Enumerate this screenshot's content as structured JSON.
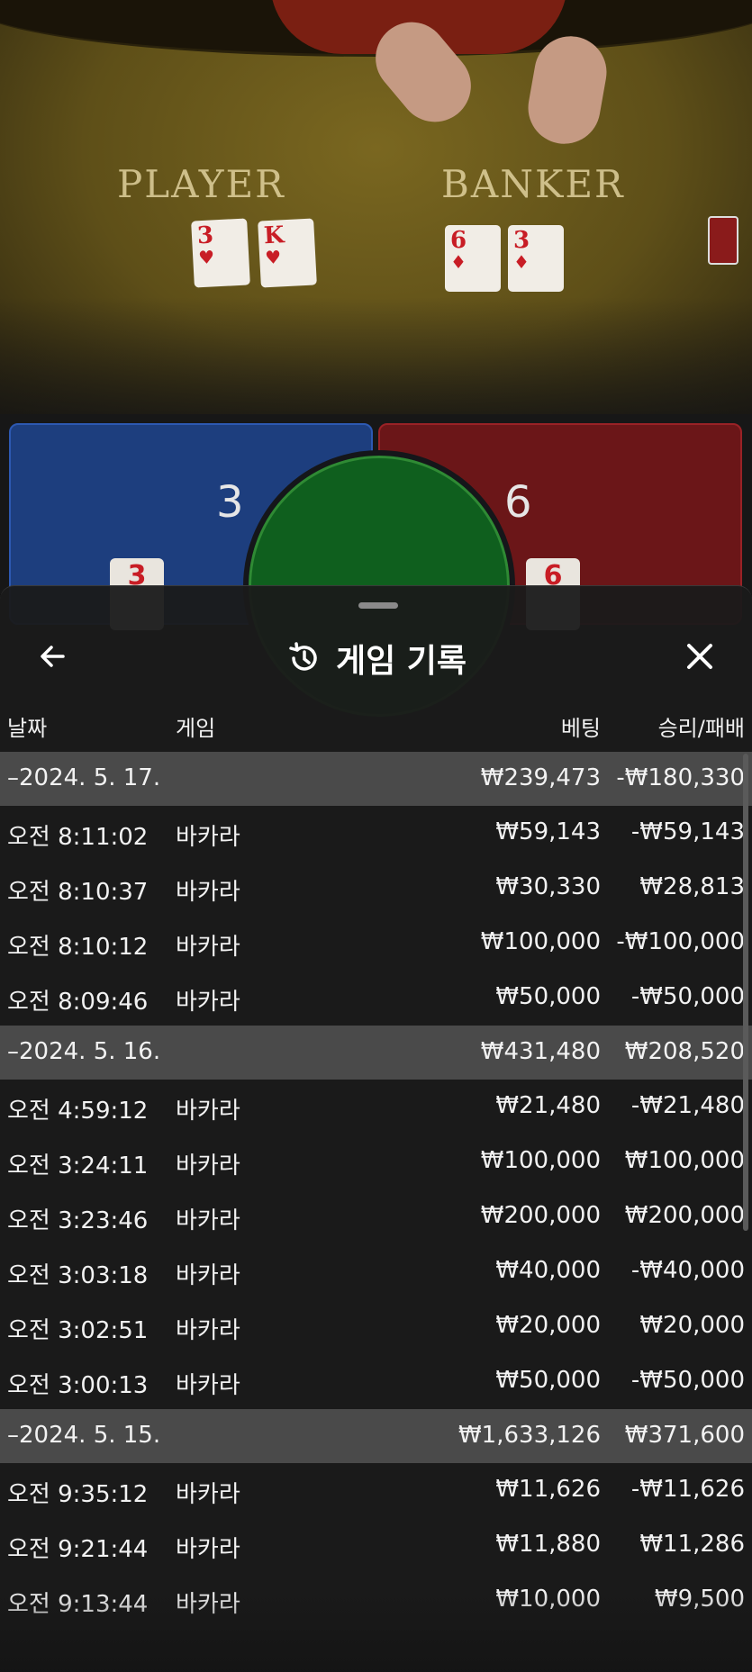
{
  "table": {
    "player_label": "PLAYER",
    "banker_label": "BANKER",
    "player_cards": [
      {
        "rank": "3",
        "suit": "♥"
      },
      {
        "rank": "K",
        "suit": "♥"
      }
    ],
    "banker_cards": [
      {
        "rank": "6",
        "suit": "♦"
      },
      {
        "rank": "3",
        "suit": "♦"
      }
    ],
    "player_score": "3",
    "banker_score": "6",
    "player_mini_card": "3",
    "banker_mini_card": "6"
  },
  "panel": {
    "title": "게임 기록",
    "columns": {
      "date": "날짜",
      "game": "게임",
      "bet": "베팅",
      "result": "승리/패배"
    },
    "groups": [
      {
        "date": "–2024. 5. 17.",
        "bet_total": "₩239,473",
        "result_total": "-₩180,330",
        "rows": [
          {
            "time": "오전 8:11:02",
            "game": "바카라",
            "bet": "₩59,143",
            "result": "-₩59,143"
          },
          {
            "time": "오전 8:10:37",
            "game": "바카라",
            "bet": "₩30,330",
            "result": "₩28,813"
          },
          {
            "time": "오전 8:10:12",
            "game": "바카라",
            "bet": "₩100,000",
            "result": "-₩100,000"
          },
          {
            "time": "오전 8:09:46",
            "game": "바카라",
            "bet": "₩50,000",
            "result": "-₩50,000"
          }
        ]
      },
      {
        "date": "–2024. 5. 16.",
        "bet_total": "₩431,480",
        "result_total": "₩208,520",
        "rows": [
          {
            "time": "오전 4:59:12",
            "game": "바카라",
            "bet": "₩21,480",
            "result": "-₩21,480"
          },
          {
            "time": "오전 3:24:11",
            "game": "바카라",
            "bet": "₩100,000",
            "result": "₩100,000"
          },
          {
            "time": "오전 3:23:46",
            "game": "바카라",
            "bet": "₩200,000",
            "result": "₩200,000"
          },
          {
            "time": "오전 3:03:18",
            "game": "바카라",
            "bet": "₩40,000",
            "result": "-₩40,000"
          },
          {
            "time": "오전 3:02:51",
            "game": "바카라",
            "bet": "₩20,000",
            "result": "₩20,000"
          },
          {
            "time": "오전 3:00:13",
            "game": "바카라",
            "bet": "₩50,000",
            "result": "-₩50,000"
          }
        ]
      },
      {
        "date": "–2024. 5. 15.",
        "bet_total": "₩1,633,126",
        "result_total": "₩371,600",
        "rows": [
          {
            "time": "오전 9:35:12",
            "game": "바카라",
            "bet": "₩11,626",
            "result": "-₩11,626"
          },
          {
            "time": "오전 9:21:44",
            "game": "바카라",
            "bet": "₩11,880",
            "result": "₩11,286"
          },
          {
            "time": "오전 9:13:44",
            "game": "바카라",
            "bet": "₩10,000",
            "result": "₩9,500"
          }
        ]
      }
    ]
  },
  "icons": {
    "back": "arrow-left-icon",
    "history": "history-icon",
    "close": "close-icon"
  },
  "colors": {
    "player_blue": "#1d3e7e",
    "banker_red": "#6b1618",
    "tie_green": "#0f5f1e",
    "date_row": "#4a4a4a"
  }
}
